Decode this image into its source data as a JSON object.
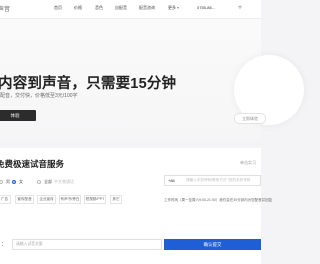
{
  "brand": {
    "text": "声音"
  },
  "nav": {
    "home": "首页",
    "price": "价格",
    "voice": "音色",
    "custom": "自配音",
    "config": "配音咨询",
    "more": "更多",
    "phone": "0755-86...",
    "center": "个"
  },
  "hero": {
    "title": "内容到声音，只需要15分钟",
    "subtitle": "配音，交付快，价格低至3元/100字",
    "button": "体验",
    "side_button": "立即体验"
  },
  "section": {
    "title": "免费极速试音服务",
    "link": "单击实习",
    "radios": [
      {
        "label": "男",
        "checked": false
      },
      {
        "label": "女",
        "checked": true
      },
      {
        "label": "全部",
        "hint": "中文普通话",
        "checked": false
      }
    ],
    "input_prefix": "+86",
    "input_placeholder": "请输入手机号码/联系方式  *您的手机号码",
    "tags": [
      "广告",
      "宣传配音",
      "企业宣传",
      "有声书/旁白",
      "短视频/PPT",
      "其它"
    ],
    "note": "工作时间（周一至周六9:00-21:00）我们会在30分钟内为您配音并回复",
    "text_prefix": "0 :",
    "text_placeholder": "请输入试音文案",
    "submit": "确认提交"
  }
}
